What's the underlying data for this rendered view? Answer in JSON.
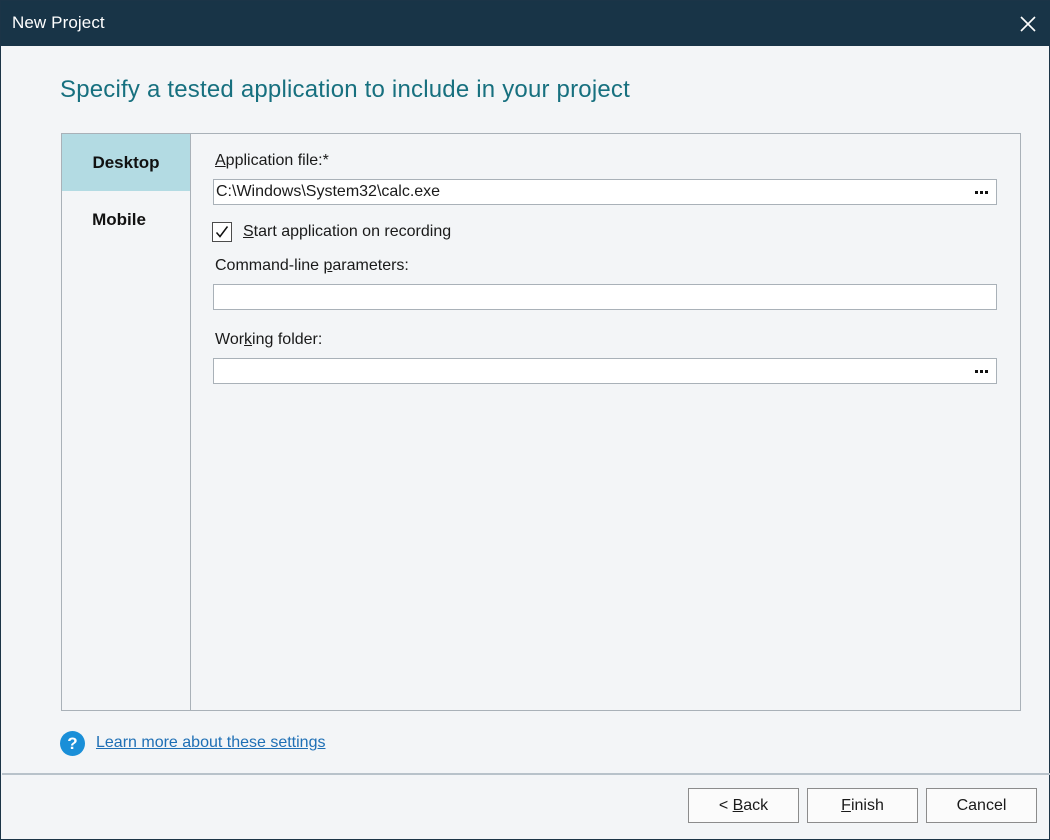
{
  "window": {
    "title": "New Project",
    "close_icon": "close-icon"
  },
  "heading": "Specify a tested application to include in your project",
  "tabs": [
    {
      "label": "Desktop",
      "active": true
    },
    {
      "label": "Mobile",
      "active": false
    }
  ],
  "desktop": {
    "app_file": {
      "label_first": "A",
      "label_rest": "pplication file:*",
      "value": "C:\\Windows\\System32\\calc.exe"
    },
    "start_on_recording": {
      "checked": true,
      "label_first": "S",
      "label_rest": "tart application on recording"
    },
    "cmd_params": {
      "label_pre": "Command-line ",
      "label_u": "p",
      "label_post": "arameters:",
      "value": ""
    },
    "working_folder": {
      "label_pre": "Wor",
      "label_u": "k",
      "label_post": "ing folder:",
      "value": ""
    }
  },
  "help": {
    "icon": "?",
    "link_text": "Learn more about these settings"
  },
  "buttons": {
    "back_prefix": "< ",
    "back_u": "B",
    "back_rest": "ack",
    "finish_u": "F",
    "finish_rest": "inish",
    "cancel": "Cancel"
  },
  "colors": {
    "titlebar": "#183447",
    "accent_text": "#17707f",
    "active_tab": "#b3dbe3",
    "link": "#1e6fb5",
    "help_icon": "#1a8fd8"
  }
}
